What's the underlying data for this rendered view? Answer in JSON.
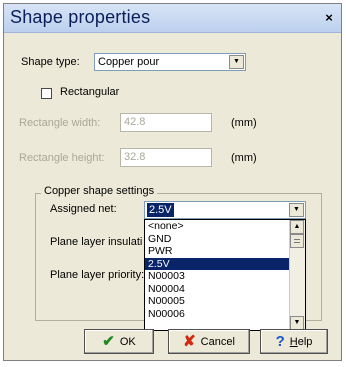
{
  "dialog": {
    "title": "Shape properties",
    "close_glyph": "×"
  },
  "shape_type": {
    "label": "Shape type:",
    "value": "Copper pour"
  },
  "rectangular": {
    "label": "Rectangular",
    "checked": false
  },
  "rect_width": {
    "label": "Rectangle width:",
    "value": "42.8",
    "unit": "(mm)"
  },
  "rect_height": {
    "label": "Rectangle height:",
    "value": "32.8",
    "unit": "(mm)"
  },
  "copper_settings": {
    "group_title": "Copper shape settings",
    "assigned_net_label": "Assigned net:",
    "assigned_net_value": "2.5V",
    "plane_insulation_label": "Plane layer insulati",
    "plane_priority_label": "Plane layer priority:",
    "net_options": [
      "<none>",
      "GND",
      "PWR",
      "2.5V",
      "N00003",
      "N00004",
      "N00005",
      "N00006"
    ],
    "selected_option": "2.5V"
  },
  "buttons": {
    "ok": {
      "label": "OK",
      "icon": "check-icon",
      "color": "#1f8a1f"
    },
    "cancel": {
      "label": "Cancel",
      "icon": "x-icon",
      "color": "#d02a10"
    },
    "help": {
      "label_underlined": "H",
      "label_rest": "elp",
      "icon": "question-icon",
      "color": "#1a56c8"
    }
  }
}
